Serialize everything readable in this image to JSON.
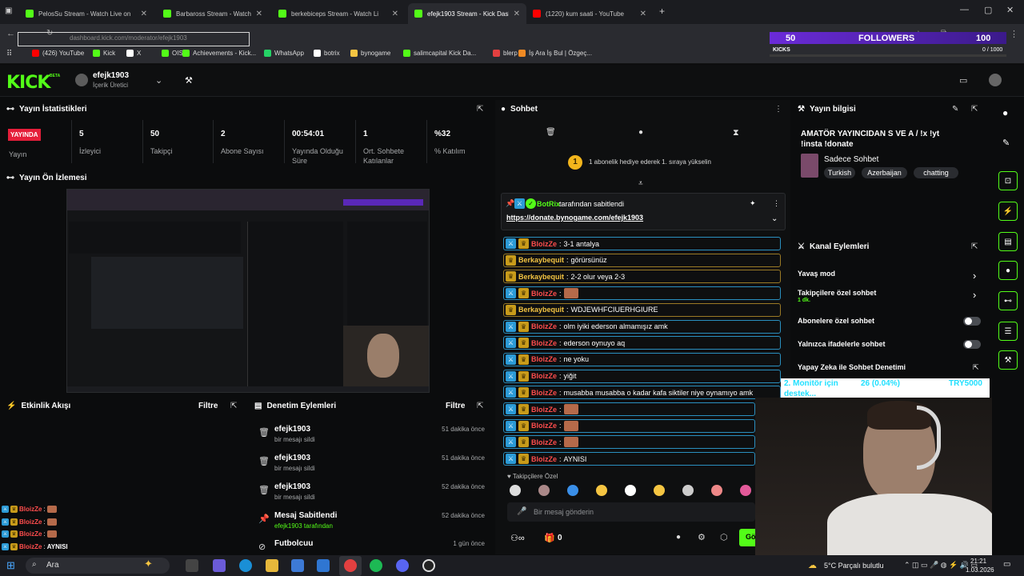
{
  "browser": {
    "tabs": [
      {
        "label": "PelosSu Stream - Watch Live on",
        "color": "#53fc18"
      },
      {
        "label": "Barbaross Stream - Watch Live",
        "color": "#53fc18"
      },
      {
        "label": "berkebiceps Stream - Watch Li",
        "color": "#53fc18"
      },
      {
        "label": "efejk1903 Stream - Kick Dashb",
        "color": "#53fc18"
      },
      {
        "label": "(1220) kum saati - YouTube",
        "color": "#ff0000"
      }
    ],
    "url": "dashboard.kick.com/moderator/efejk1903",
    "bookmarks": [
      {
        "label": "(426) YouTube",
        "color": "#ff0000"
      },
      {
        "label": "Kick",
        "color": "#53fc18"
      },
      {
        "label": "X",
        "color": "#ffffff"
      },
      {
        "label": "OIS",
        "color": "#53fc18"
      },
      {
        "label": "Achievements - Kick...",
        "color": "#53fc18"
      },
      {
        "label": "WhatsApp",
        "color": "#25d366"
      },
      {
        "label": "botrix",
        "color": "#ffffff"
      },
      {
        "label": "bynogame",
        "color": "#f5c542"
      },
      {
        "label": "salimcapital Kick Da...",
        "color": "#53fc18"
      },
      {
        "label": "blerp",
        "color": "#e34040"
      },
      {
        "label": "İş Ara İş Bul | Özgeç...",
        "color": "#f08a24"
      }
    ]
  },
  "goal": {
    "count": "50",
    "label": "FOLLOWERS",
    "target": "100",
    "kicks_label": "KICKS",
    "kicks_value": "0 / 1000"
  },
  "header": {
    "logo": "KICK",
    "beta": "BETA",
    "username": "efejk1903",
    "role": "İçerik Üretici"
  },
  "stats": {
    "title": "Yayın İstatistikleri",
    "live_badge": "YAYINDA",
    "live_label": "Yayın",
    "items": [
      {
        "value": "5",
        "label": "İzleyici"
      },
      {
        "value": "50",
        "label": "Takipçi"
      },
      {
        "value": "2",
        "label": "Abone Sayısı"
      },
      {
        "value": "00:54:01",
        "label": "Yayında Olduğu Süre"
      },
      {
        "value": "1",
        "label": "Ort. Sohbete Katılanlar"
      },
      {
        "value": "%32",
        "label": "% Katılım"
      }
    ]
  },
  "preview": {
    "title": "Yayın Ön İzlemesi"
  },
  "activity": {
    "title": "Etkinlik Akışı",
    "filter": "Filtre",
    "lines": [
      {
        "user": "BloizZe",
        "text": ""
      },
      {
        "user": "BloizZe",
        "text": ""
      },
      {
        "user": "BloizZe",
        "text": ""
      },
      {
        "user": "BloizZe",
        "text": "AYNISI"
      }
    ]
  },
  "moderation": {
    "title": "Denetim Eylemleri",
    "filter": "Filtre",
    "items": [
      {
        "name": "efejk1903",
        "sub": "bir mesajı sildi",
        "time": "51 dakika önce"
      },
      {
        "name": "efejk1903",
        "sub": "bir mesajı sildi",
        "time": "51 dakika önce"
      },
      {
        "name": "efejk1903",
        "sub": "bir mesajı sildi",
        "time": "52 dakika önce"
      },
      {
        "name": "Mesaj Sabitlendi",
        "sub": "efejk1903 tarafından",
        "time": "52 dakika önce"
      },
      {
        "name": "Futbolcuu",
        "sub": "",
        "time": "1 gün önce"
      }
    ]
  },
  "chat": {
    "title": "Sohbet",
    "gift_count": "1",
    "gift_text": "1 abonelik hediye ederek 1. sıraya yükselin",
    "pinned_by": "BotRix",
    "pinned_suffix": "tarafından sabitlendi",
    "pinned_link": "https://donate.bynogame.com/efejk1903",
    "messages": [
      {
        "user": "BloizZe",
        "text": "3-1 antalya",
        "color": "#ff4d4d",
        "border": "blue",
        "mod": true
      },
      {
        "user": "Berkaybequit",
        "text": "görürsünüz",
        "color": "#f5c542",
        "border": "gold",
        "mod": false
      },
      {
        "user": "Berkaybequit",
        "text": "2-2 olur veya 2-3",
        "color": "#f5c542",
        "border": "gold",
        "mod": false
      },
      {
        "user": "BloizZe",
        "text": "",
        "color": "#ff4d4d",
        "border": "blue",
        "mod": true,
        "emote": true
      },
      {
        "user": "Berkaybequit",
        "text": "WDJEWHFCIUERHGIURE",
        "color": "#f5c542",
        "border": "gold",
        "mod": false
      },
      {
        "user": "BloizZe",
        "text": "olm iyiki ederson almamışız amk",
        "color": "#ff4d4d",
        "border": "blue",
        "mod": true
      },
      {
        "user": "BloizZe",
        "text": "ederson oynuyo aq",
        "color": "#ff4d4d",
        "border": "blue",
        "mod": true
      },
      {
        "user": "BloizZe",
        "text": "ne yoku",
        "color": "#ff4d4d",
        "border": "blue",
        "mod": true
      },
      {
        "user": "BloizZe",
        "text": "yiğit",
        "color": "#ff4d4d",
        "border": "blue",
        "mod": true
      },
      {
        "user": "BloizZe",
        "text": "musabba musabba o kadar kafa siktiler niye oynamıyo amk",
        "color": "#ff4d4d",
        "border": "blue",
        "mod": true
      },
      {
        "user": "BloizZe",
        "text": "",
        "color": "#ff4d4d",
        "border": "blue",
        "mod": true,
        "emote": true
      },
      {
        "user": "BloizZe",
        "text": "",
        "color": "#ff4d4d",
        "border": "blue",
        "mod": true,
        "emote": true
      },
      {
        "user": "BloizZe",
        "text": "",
        "color": "#ff4d4d",
        "border": "blue",
        "mod": true,
        "emote": true
      },
      {
        "user": "BloizZe",
        "text": "AYNISI",
        "color": "#ff4d4d",
        "border": "blue",
        "mod": true
      }
    ],
    "followers_only": "Takipçilere Özel",
    "input_placeholder": "Bir mesaj gönderin",
    "points": "0",
    "send_label": "Gö"
  },
  "stream_info": {
    "title": "Yayın bilgisi",
    "stream_title": "AMATÖR YAYINCIDAN S VE A / !x !yt !insta !donate",
    "category": "Sadece Sohbet",
    "tags": [
      "Turkish",
      "Azerbaijan",
      "chatting"
    ]
  },
  "channel_actions": {
    "title": "Kanal Eylemleri",
    "items": [
      {
        "label": "Yavaş mod",
        "sub": "",
        "control": "chevron"
      },
      {
        "label": "Takipçilere özel sohbet",
        "sub": "1 dk.",
        "control": "chevron"
      },
      {
        "label": "Abonelere özel sohbet",
        "sub": "",
        "control": "toggle"
      },
      {
        "label": "Yalnızca ifadelerle sohbet",
        "sub": "",
        "control": "toggle"
      },
      {
        "label": "Yapay Zeka ile Sohbet Denetimi",
        "sub": "",
        "control": "external"
      }
    ]
  },
  "overlay": {
    "rank": "2. Monitör için",
    "rank2": "destek...",
    "value": "26 (0.04%)",
    "currency": "TRY5000"
  },
  "taskbar": {
    "search": "Ara",
    "weather": "5°C  Parçalı bulutlu",
    "time": "21:21",
    "date": "1.03.2026"
  }
}
